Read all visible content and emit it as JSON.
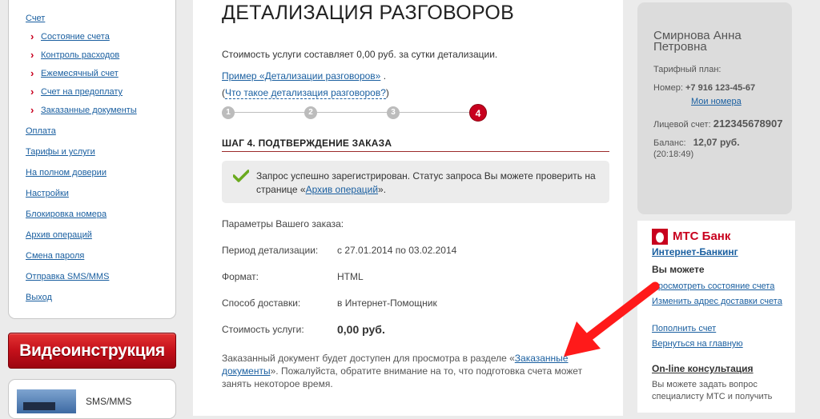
{
  "sidebar": {
    "items": [
      {
        "label": "Счет",
        "sub": false
      },
      {
        "label": "Состояние счета",
        "sub": true
      },
      {
        "label": "Контроль расходов",
        "sub": true
      },
      {
        "label": "Ежемесячный счет",
        "sub": true
      },
      {
        "label": "Счет на предоплату",
        "sub": true
      },
      {
        "label": "Заказанные документы",
        "sub": true
      },
      {
        "label": "Оплата",
        "sub": false
      },
      {
        "label": "Тарифы и услуги",
        "sub": false
      },
      {
        "label": "На полном доверии",
        "sub": false
      },
      {
        "label": "Настройки",
        "sub": false
      },
      {
        "label": "Блокировка номера",
        "sub": false
      },
      {
        "label": "Архив операций",
        "sub": false
      },
      {
        "label": "Смена пароля",
        "sub": false
      },
      {
        "label": "Отправка SMS/MMS",
        "sub": false
      },
      {
        "label": "Выход",
        "sub": false
      }
    ],
    "video_button": "Видеоинструкция",
    "sms_box": "SMS/MMS"
  },
  "main": {
    "title": "ДЕТАЛИЗАЦИЯ РАЗГОВОРОВ",
    "cost_text": "Стоимость услуги составляет 0,00 руб. за сутки детализации.",
    "example_link": "Пример «Детализации разговоров»",
    "example_suffix": " .",
    "what_prefix": "(",
    "what_link": "Что такое детализация разговоров?",
    "what_suffix": ")",
    "steps": [
      "1",
      "2",
      "3",
      "4"
    ],
    "active_step": 4,
    "step_title": "ШАГ 4. ПОДТВЕРЖДЕНИЕ ЗАКАЗА",
    "success_text_1": "Запрос успешно зарегистрирован. Статус запроса Вы можете проверить на странице «",
    "success_link": "Архив операций",
    "success_text_2": "».",
    "params_title": "Параметры Вашего заказа:",
    "params": [
      {
        "label": "Период детализации:",
        "value": "с 27.01.2014 по 03.02.2014"
      },
      {
        "label": "Формат:",
        "value": "HTML"
      },
      {
        "label": "Способ доставки:",
        "value": "в Интернет-Помощник"
      },
      {
        "label": "Стоимость услуги:",
        "value": "0,00 руб."
      }
    ],
    "note_1": "Заказанный документ будет доступен для просмотра в разделе «",
    "note_link": "Заказанные документы",
    "note_2": "». Пожалуйста, обратите внимание на то, что подготовка счета может занять некоторое время."
  },
  "profile": {
    "name": "Смирнова Анна Петровна",
    "tariff_label": "Тарифный план:",
    "number_label": "Номер:",
    "number_value": "+7 916 123-45-67",
    "my_numbers": "Мои номера",
    "account_label": "Лицевой счет:",
    "account_value": "212345678907",
    "balance_label": "Баланс:",
    "balance_value": "12,07 руб.",
    "balance_time": "(20:18:49)"
  },
  "bank": {
    "name": "МТС Банк",
    "internet_banking": "Интернет-Банкинг",
    "you_can": "Вы можете",
    "links": [
      "Просмотреть состояние счета",
      "Изменить адрес доставки счета",
      "Пополнить счет",
      "Вернуться на главную"
    ],
    "online_title": "On-line консультация",
    "online_text": "Вы можете задать вопрос специалисту МТС и получить"
  },
  "colors": {
    "brand_red": "#c8001e",
    "link_blue": "#1a5fa0",
    "arrow_red": "#ff1a1a",
    "success_green": "#6aaa1e"
  }
}
